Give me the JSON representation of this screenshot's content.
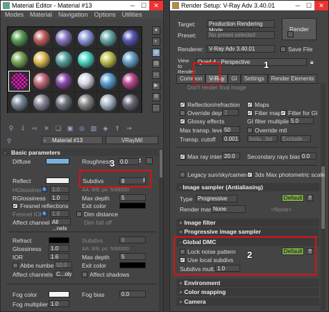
{
  "material_editor": {
    "title": "Material Editor - Material #13",
    "menu": [
      "Modes",
      "Material",
      "Navigation",
      "Options",
      "Utilities"
    ],
    "slot_colors": [
      "#5aa05a",
      "#c06060",
      "#8878c0",
      "#8a9ad8",
      "#6aa8a8",
      "#5858b8",
      "#7aa858",
      "#ddbb55",
      "#5aa0a0",
      "#4ad8c8",
      "#c0c050",
      "#68a0c8",
      "#8a3030",
      "#c06a7a",
      "#8a4aa8",
      "#d8d8e8",
      "#5aa0d0",
      "#b84a90",
      "#7a8a9a",
      "#8a8898",
      "#707480",
      "#888888",
      "#a8b8c8",
      "#6a6a7a"
    ],
    "material_name": "Material #13",
    "material_type": "VRayMtl",
    "basic_parameters": "Basic parameters",
    "diffuse": "Diffuse",
    "roughness": "Roughness",
    "roughness_val": "0.0",
    "reflect": "Reflect",
    "subdivs": "Subdivs",
    "subdivs_val": "8",
    "hglossiness": "HGlossiness",
    "hgloss_val": "1.0",
    "aa": "AA: 8/8; px: 5/66000",
    "rglossiness": "RGlossiness",
    "rgloss_val": "1.0",
    "max_depth": "Max depth",
    "max_depth_val": "5",
    "fresnel": "Fresnel reflections",
    "exit_color": "Exit color",
    "fresnel_ior": "Fresnel IOR",
    "fresnel_ior_val": "1.6",
    "dim_distance": "Dim distance",
    "affect_channels": "Affect channels",
    "affect_ch_val": "All ...nels",
    "dim_falloff": "Dim fall off",
    "refract": "Refract",
    "glossiness": "Glossiness",
    "gloss_val": "1.0",
    "refr_subdivs_val": "8",
    "aa2": "AA: 8/8; px: 5/66000",
    "ior": "IOR",
    "ior_val": "1.6",
    "refr_maxdepth_val": "5",
    "abbe": "Abbe number",
    "abbe_val": "50.0",
    "exit_color2": "Exit color",
    "affect_shadows": "Affect shadows",
    "affect_ch_val2": "C...oly",
    "fog_color": "Fog color",
    "fog_bias": "Fog bias",
    "fog_bias_val": "0.0",
    "fog_multiplier": "Fog multiplier",
    "fog_mult_val": "1.0",
    "callout_3": "3"
  },
  "render_setup": {
    "title": "Render Setup: V-Ray Adv 3.40.01",
    "target_label": "Target:",
    "target_val": "Production Rendering Mode",
    "preset_label": "Preset:",
    "preset_val": "No preset selected",
    "renderer_label": "Renderer:",
    "renderer_val": "V-Ray Adv 3.40.01",
    "save_file": "Save File",
    "render_btn": "Render",
    "view_label": "View to Render:",
    "view_val": "Quad 4 - Perspective",
    "tabs": [
      "Common",
      "V-Ray",
      "GI",
      "Settings",
      "Render Elements"
    ],
    "callout_1": "1",
    "frag_top": "Don't render final image",
    "reflection": "Reflection/refraction",
    "maps": "Maps",
    "override_depth": "Override depth",
    "override_depth_val": "2",
    "filter_maps": "Filter maps",
    "filter_gi": "Filter for GI",
    "glossy": "Glossy effects",
    "gi_filter_mult": "GI filter multiplier",
    "gi_filter_val": "5.0",
    "max_transp": "Max transp. levels",
    "max_transp_val": "50",
    "override_mtl": "Override mtl",
    "transp_cutoff": "Transp. cutoff",
    "transp_cutoff_val": "0.001",
    "include": "Inclu...list",
    "exclude": "Exclude...",
    "max_ray": "Max ray intens.",
    "max_ray_val": "20.0",
    "sec_ray": "Secondary rays bias",
    "sec_ray_val": "0.0",
    "legacy": "Legacy sun/sky/camera",
    "photometric": "3ds Max photometric scale",
    "img_sampler": "Image sampler (Antialiasing)",
    "type": "Type",
    "type_val": "Progressive",
    "default": "Default",
    "render_mask": "Render mask",
    "render_mask_val": "None",
    "none": "<None>",
    "image_filter": "Image filter",
    "prog_sampler": "Progressive image sampler",
    "global_dmc": "Global DMC",
    "lock_noise": "Lock noise pattern",
    "default2": "Default",
    "use_local": "Use local subdivs",
    "subdivs_mult": "Subdivs mult.",
    "subdivs_mult_val": "1.0",
    "callout_2": "2",
    "environment": "Environment",
    "color_mapping": "Color mapping",
    "camera": "Camera"
  }
}
